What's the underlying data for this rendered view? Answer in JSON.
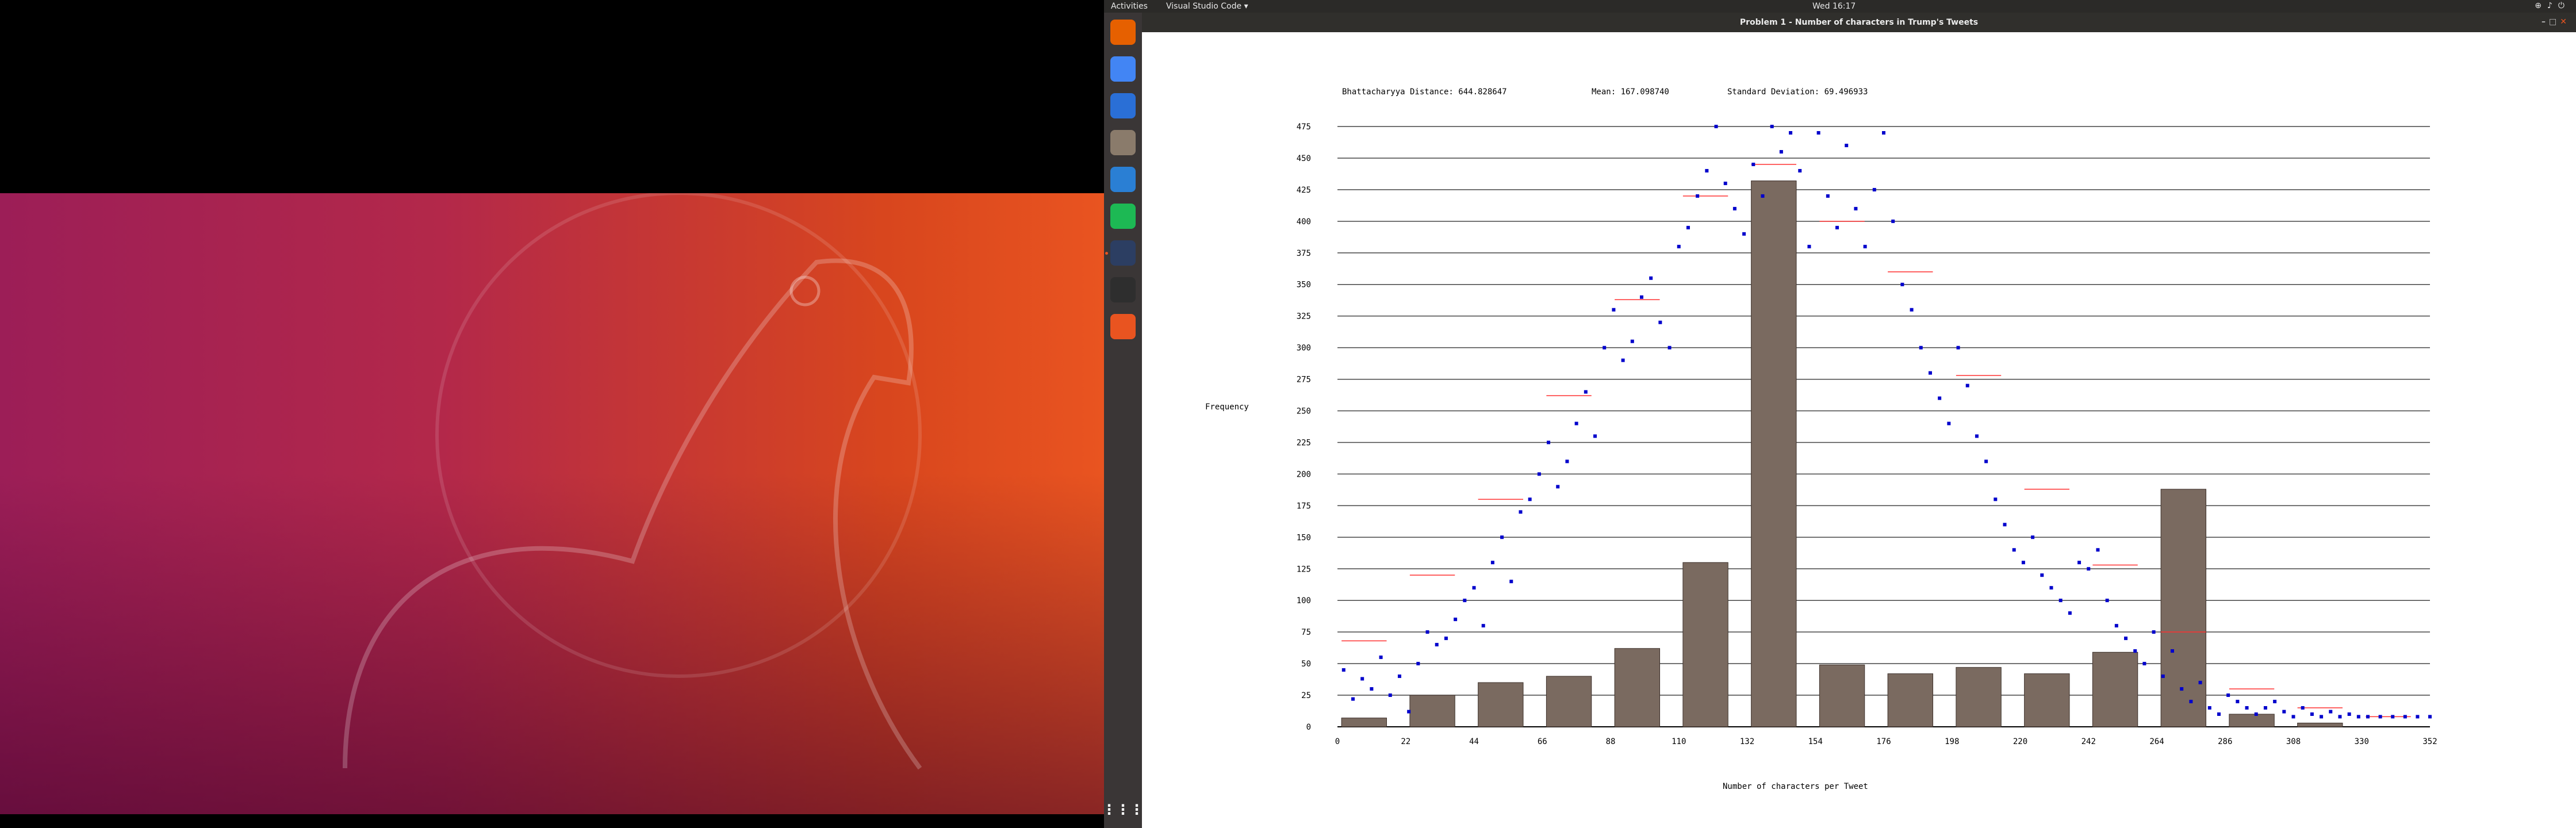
{
  "topbar": {
    "activities": "Activities",
    "app_menu": "Visual Studio Code ▾",
    "clock": "Wed 16:17"
  },
  "window": {
    "title": "Problem 1 - Number of characters in Trump's Tweets"
  },
  "dock": {
    "items": [
      {
        "icon": "firefox-icon",
        "color": "#e66000"
      },
      {
        "icon": "chrome-icon",
        "color": "#4285f4"
      },
      {
        "icon": "thunderbird-icon",
        "color": "#2a6fd6"
      },
      {
        "icon": "files-icon",
        "color": "#8a7b6b"
      },
      {
        "icon": "libreoffice-writer-icon",
        "color": "#2a7fd4"
      },
      {
        "icon": "spotify-icon",
        "color": "#1db954"
      },
      {
        "icon": "vscode-icon",
        "color": "#2c3e62"
      },
      {
        "icon": "terminal-icon",
        "color": "#2e2e2e"
      },
      {
        "icon": "help-icon",
        "color": "#e95420"
      }
    ],
    "grid_label": "apps-grid-icon"
  },
  "chart_info": {
    "bhattacharyya": "Bhattacharyya Distance: 644.828647",
    "mean": "Mean: 167.098740",
    "stddev": "Standard Deviation: 69.496933"
  },
  "chart_data": {
    "type": "bar",
    "xlabel": "Number of characters per Tweet",
    "ylabel": "Frequency",
    "ylim": [
      0,
      475
    ],
    "yticks": [
      0,
      25,
      50,
      75,
      100,
      125,
      150,
      175,
      200,
      225,
      250,
      275,
      300,
      325,
      350,
      375,
      400,
      425,
      450,
      475
    ],
    "xticks": [
      0,
      22,
      44,
      66,
      88,
      110,
      132,
      154,
      176,
      198,
      220,
      242,
      264,
      286,
      308,
      330,
      352
    ],
    "xlim": [
      0,
      352
    ],
    "bin_width": 22,
    "grid": true,
    "bar_color": "#7a6a60",
    "bars": [
      {
        "x": 0,
        "value": 7
      },
      {
        "x": 22,
        "value": 25
      },
      {
        "x": 44,
        "value": 35
      },
      {
        "x": 66,
        "value": 40
      },
      {
        "x": 88,
        "value": 62
      },
      {
        "x": 110,
        "value": 130
      },
      {
        "x": 132,
        "value": 432
      },
      {
        "x": 154,
        "value": 49
      },
      {
        "x": 176,
        "value": 42
      },
      {
        "x": 198,
        "value": 47
      },
      {
        "x": 220,
        "value": 42
      },
      {
        "x": 242,
        "value": 59
      },
      {
        "x": 264,
        "value": 188
      },
      {
        "x": 286,
        "value": 10
      },
      {
        "x": 308,
        "value": 3
      },
      {
        "x": 330,
        "value": 0
      }
    ],
    "scatter_color": "#0000cc",
    "scatter": [
      {
        "x": 2,
        "y": 45
      },
      {
        "x": 5,
        "y": 22
      },
      {
        "x": 8,
        "y": 38
      },
      {
        "x": 11,
        "y": 30
      },
      {
        "x": 14,
        "y": 55
      },
      {
        "x": 17,
        "y": 25
      },
      {
        "x": 20,
        "y": 40
      },
      {
        "x": 23,
        "y": 12
      },
      {
        "x": 26,
        "y": 50
      },
      {
        "x": 29,
        "y": 75
      },
      {
        "x": 32,
        "y": 65
      },
      {
        "x": 35,
        "y": 70
      },
      {
        "x": 38,
        "y": 85
      },
      {
        "x": 41,
        "y": 100
      },
      {
        "x": 44,
        "y": 110
      },
      {
        "x": 47,
        "y": 80
      },
      {
        "x": 50,
        "y": 130
      },
      {
        "x": 53,
        "y": 150
      },
      {
        "x": 56,
        "y": 115
      },
      {
        "x": 59,
        "y": 170
      },
      {
        "x": 62,
        "y": 180
      },
      {
        "x": 65,
        "y": 200
      },
      {
        "x": 68,
        "y": 225
      },
      {
        "x": 71,
        "y": 190
      },
      {
        "x": 74,
        "y": 210
      },
      {
        "x": 77,
        "y": 240
      },
      {
        "x": 80,
        "y": 265
      },
      {
        "x": 83,
        "y": 230
      },
      {
        "x": 86,
        "y": 300
      },
      {
        "x": 89,
        "y": 330
      },
      {
        "x": 92,
        "y": 290
      },
      {
        "x": 95,
        "y": 305
      },
      {
        "x": 98,
        "y": 340
      },
      {
        "x": 101,
        "y": 355
      },
      {
        "x": 104,
        "y": 320
      },
      {
        "x": 107,
        "y": 300
      },
      {
        "x": 110,
        "y": 380
      },
      {
        "x": 113,
        "y": 395
      },
      {
        "x": 116,
        "y": 420
      },
      {
        "x": 119,
        "y": 440
      },
      {
        "x": 122,
        "y": 475
      },
      {
        "x": 125,
        "y": 430
      },
      {
        "x": 128,
        "y": 410
      },
      {
        "x": 131,
        "y": 390
      },
      {
        "x": 134,
        "y": 445
      },
      {
        "x": 137,
        "y": 420
      },
      {
        "x": 140,
        "y": 475
      },
      {
        "x": 143,
        "y": 455
      },
      {
        "x": 146,
        "y": 470
      },
      {
        "x": 149,
        "y": 440
      },
      {
        "x": 152,
        "y": 380
      },
      {
        "x": 155,
        "y": 470
      },
      {
        "x": 158,
        "y": 420
      },
      {
        "x": 161,
        "y": 395
      },
      {
        "x": 164,
        "y": 460
      },
      {
        "x": 167,
        "y": 410
      },
      {
        "x": 170,
        "y": 380
      },
      {
        "x": 173,
        "y": 425
      },
      {
        "x": 176,
        "y": 470
      },
      {
        "x": 179,
        "y": 400
      },
      {
        "x": 182,
        "y": 350
      },
      {
        "x": 185,
        "y": 330
      },
      {
        "x": 188,
        "y": 300
      },
      {
        "x": 191,
        "y": 280
      },
      {
        "x": 194,
        "y": 260
      },
      {
        "x": 197,
        "y": 240
      },
      {
        "x": 200,
        "y": 300
      },
      {
        "x": 203,
        "y": 270
      },
      {
        "x": 206,
        "y": 230
      },
      {
        "x": 209,
        "y": 210
      },
      {
        "x": 212,
        "y": 180
      },
      {
        "x": 215,
        "y": 160
      },
      {
        "x": 218,
        "y": 140
      },
      {
        "x": 221,
        "y": 130
      },
      {
        "x": 224,
        "y": 150
      },
      {
        "x": 227,
        "y": 120
      },
      {
        "x": 230,
        "y": 110
      },
      {
        "x": 233,
        "y": 100
      },
      {
        "x": 236,
        "y": 90
      },
      {
        "x": 239,
        "y": 130
      },
      {
        "x": 242,
        "y": 125
      },
      {
        "x": 245,
        "y": 140
      },
      {
        "x": 248,
        "y": 100
      },
      {
        "x": 251,
        "y": 80
      },
      {
        "x": 254,
        "y": 70
      },
      {
        "x": 257,
        "y": 60
      },
      {
        "x": 260,
        "y": 50
      },
      {
        "x": 263,
        "y": 75
      },
      {
        "x": 266,
        "y": 40
      },
      {
        "x": 269,
        "y": 60
      },
      {
        "x": 272,
        "y": 30
      },
      {
        "x": 275,
        "y": 20
      },
      {
        "x": 278,
        "y": 35
      },
      {
        "x": 281,
        "y": 15
      },
      {
        "x": 284,
        "y": 10
      },
      {
        "x": 287,
        "y": 25
      },
      {
        "x": 290,
        "y": 20
      },
      {
        "x": 293,
        "y": 15
      },
      {
        "x": 296,
        "y": 10
      },
      {
        "x": 299,
        "y": 15
      },
      {
        "x": 302,
        "y": 20
      },
      {
        "x": 305,
        "y": 12
      },
      {
        "x": 308,
        "y": 8
      },
      {
        "x": 311,
        "y": 15
      },
      {
        "x": 314,
        "y": 10
      },
      {
        "x": 317,
        "y": 8
      },
      {
        "x": 320,
        "y": 12
      },
      {
        "x": 323,
        "y": 8
      },
      {
        "x": 326,
        "y": 10
      },
      {
        "x": 329,
        "y": 8
      },
      {
        "x": 332,
        "y": 8
      },
      {
        "x": 336,
        "y": 8
      },
      {
        "x": 340,
        "y": 8
      },
      {
        "x": 344,
        "y": 8
      },
      {
        "x": 348,
        "y": 8
      },
      {
        "x": 352,
        "y": 8
      }
    ],
    "mean_line_color": "#ff3030",
    "bin_means": [
      {
        "x": 0,
        "y": 68
      },
      {
        "x": 22,
        "y": 120
      },
      {
        "x": 44,
        "y": 180
      },
      {
        "x": 66,
        "y": 262
      },
      {
        "x": 88,
        "y": 338
      },
      {
        "x": 110,
        "y": 420
      },
      {
        "x": 132,
        "y": 445
      },
      {
        "x": 154,
        "y": 400
      },
      {
        "x": 176,
        "y": 360
      },
      {
        "x": 198,
        "y": 278
      },
      {
        "x": 220,
        "y": 188
      },
      {
        "x": 242,
        "y": 128
      },
      {
        "x": 264,
        "y": 75
      },
      {
        "x": 286,
        "y": 30
      },
      {
        "x": 308,
        "y": 15
      },
      {
        "x": 330,
        "y": 8
      }
    ]
  }
}
